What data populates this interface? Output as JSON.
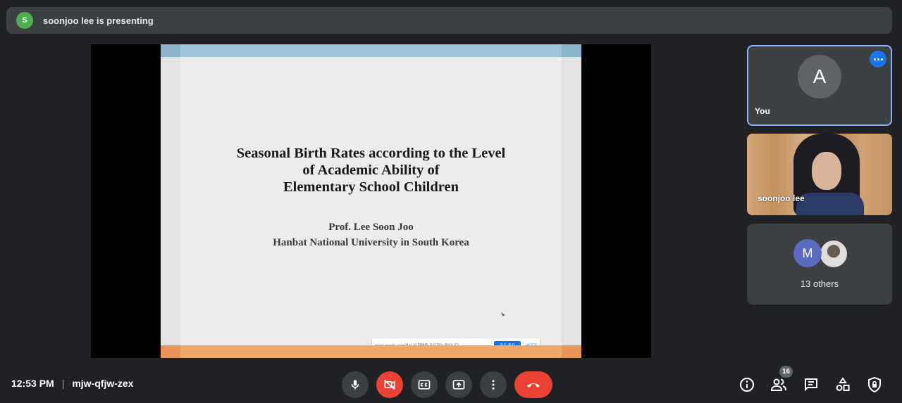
{
  "presenting_bar": {
    "avatar_initial": "S",
    "text": "soonjoo lee is presenting"
  },
  "slide": {
    "title_lines": [
      "Seasonal Birth Rates according to the Level",
      "of Academic Ability of",
      "Elementary School Children"
    ],
    "author": "Prof. Lee Soon Joo",
    "affiliation": "Hanbat National University in South Korea",
    "share_popup": {
      "text": "meet.google.com에서 내 화면을 공유하는 중입니다.",
      "stop_label": "공유 중지",
      "hide_label": "숨기기"
    }
  },
  "participants": {
    "you": {
      "initial": "A",
      "name": "You"
    },
    "speaker": {
      "name": "soonjoo lee"
    },
    "others": {
      "initial": "M",
      "label": "13 others"
    }
  },
  "meeting": {
    "time": "12:53 PM",
    "separator": "|",
    "code": "mjw-qfjw-zex"
  },
  "people_count": "16",
  "colors": {
    "background": "#202124",
    "tile": "#3c4043",
    "accent": "#1a73e8",
    "danger": "#ea4335"
  },
  "icons": [
    "mic-icon",
    "camera-off-icon",
    "captions-icon",
    "present-icon",
    "more-vert-icon",
    "hang-up-icon",
    "info-icon",
    "people-icon",
    "chat-icon",
    "activities-icon",
    "host-controls-icon"
  ]
}
